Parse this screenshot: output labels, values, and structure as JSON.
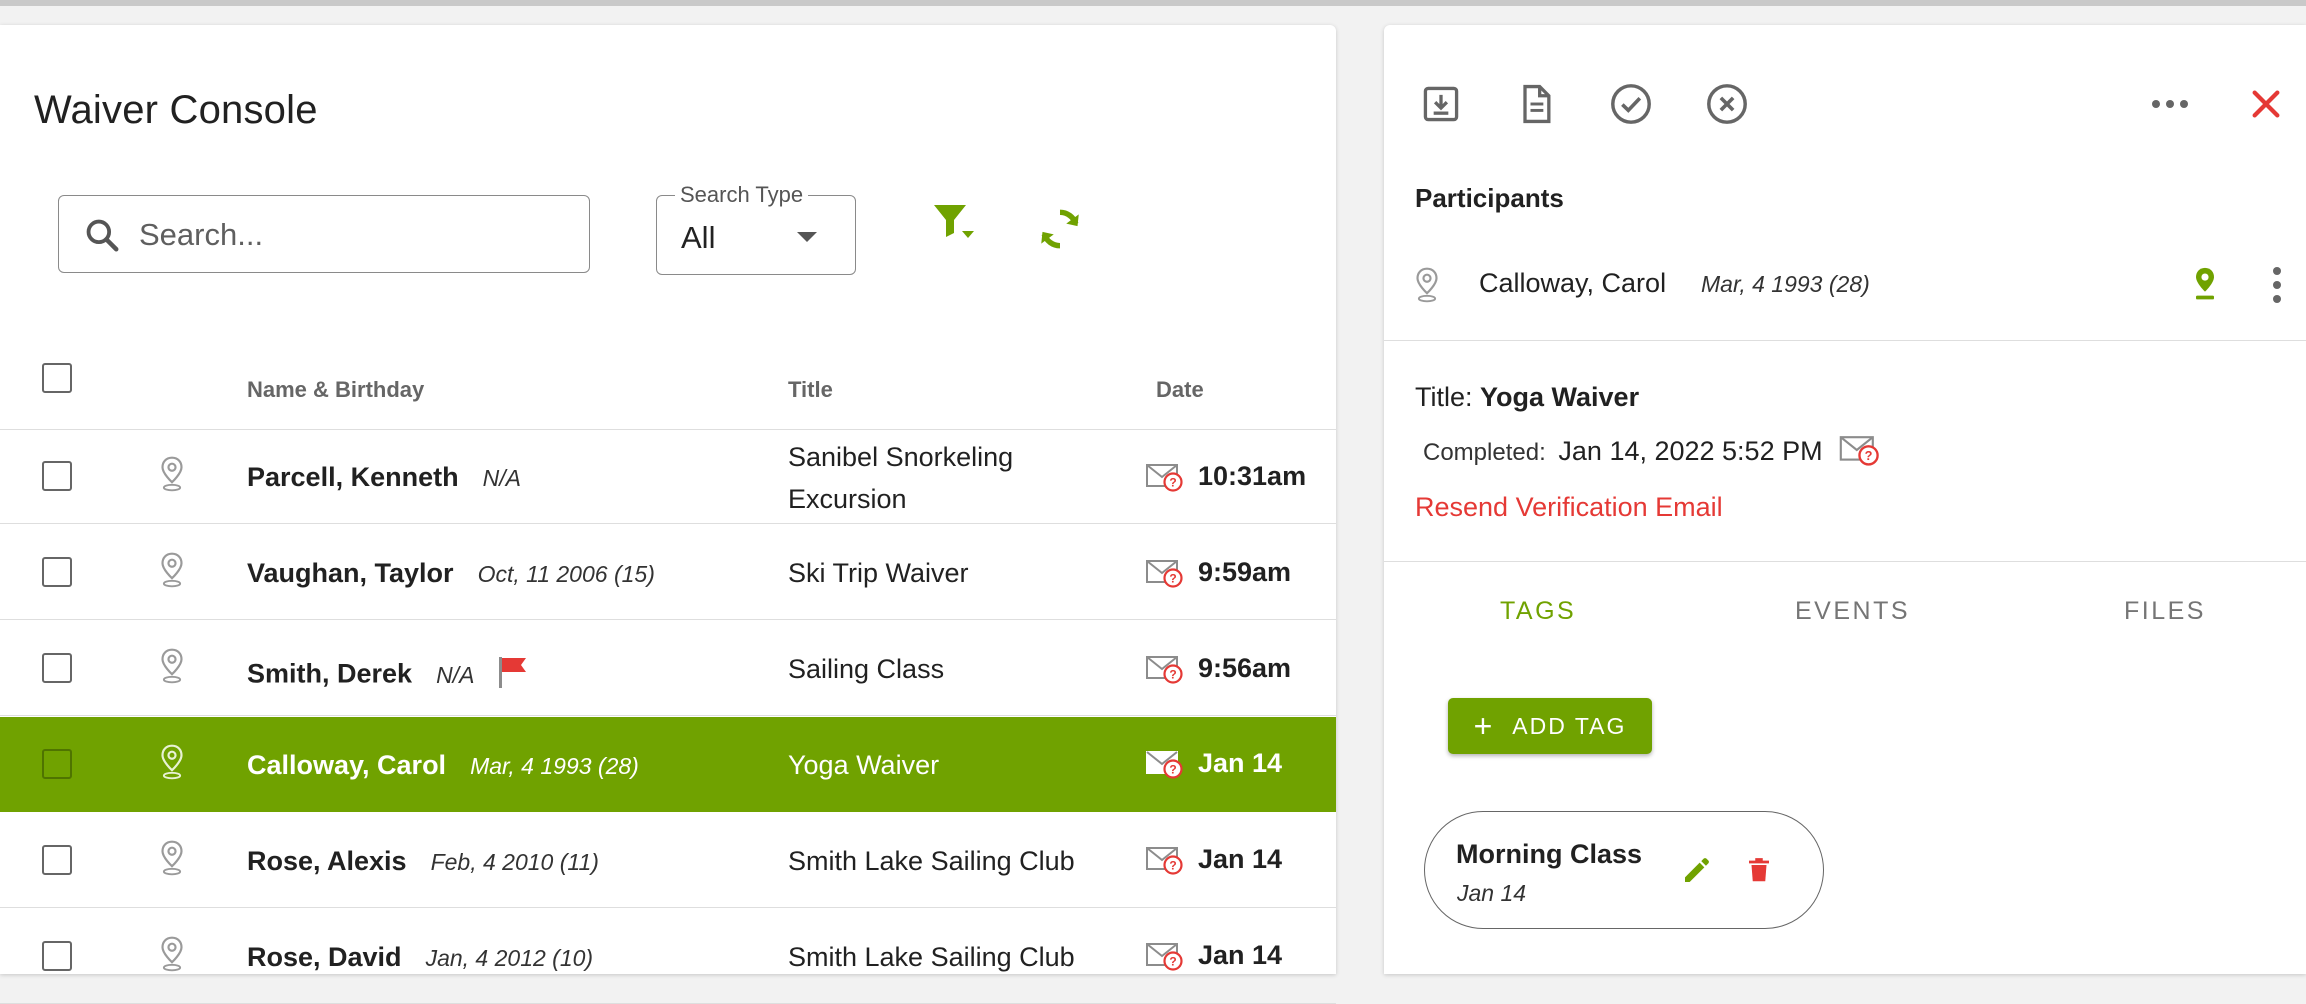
{
  "console": {
    "title": "Waiver Console",
    "search_placeholder": "Search...",
    "search_type_label": "Search Type",
    "search_type_value": "All",
    "filter_icon": "filter-icon",
    "refresh_icon": "refresh-icon"
  },
  "table": {
    "columns": [
      "Name & Birthday",
      "Title",
      "Date"
    ],
    "rows": [
      {
        "name": "Parcell, Kenneth",
        "birthday": "N/A",
        "title": "Sanibel Snorkeling Excursion",
        "time": "10:31am",
        "flagged": false,
        "selected": false
      },
      {
        "name": "Vaughan, Taylor",
        "birthday": "Oct, 11 2006 (15)",
        "title": "Ski Trip Waiver",
        "time": "9:59am",
        "flagged": false,
        "selected": false
      },
      {
        "name": "Smith, Derek",
        "birthday": "N/A",
        "title": "Sailing Class",
        "time": "9:56am",
        "flagged": true,
        "selected": false
      },
      {
        "name": "Calloway, Carol",
        "birthday": "Mar, 4 1993 (28)",
        "title": "Yoga Waiver",
        "time": "Jan 14",
        "flagged": false,
        "selected": true
      },
      {
        "name": "Rose, Alexis",
        "birthday": "Feb, 4 2010 (11)",
        "title": "Smith Lake Sailing Club",
        "time": "Jan 14",
        "flagged": false,
        "selected": false
      },
      {
        "name": "Rose, David",
        "birthday": "Jan, 4 2012 (10)",
        "title": "Smith Lake Sailing Club",
        "time": "Jan 14",
        "flagged": false,
        "selected": false
      }
    ]
  },
  "detail": {
    "toolbar_icons": [
      "download-icon",
      "document-icon",
      "check-circle-icon",
      "cancel-circle-icon",
      "more-horizontal-icon",
      "close-icon"
    ],
    "participants_label": "Participants",
    "participant": {
      "name": "Calloway, Carol",
      "birthday": "Mar, 4 1993 (28)"
    },
    "title_label": "Title:",
    "title_value": "Yoga Waiver",
    "completed_label": "Completed:",
    "completed_value": "Jan 14, 2022 5:52 PM",
    "resend_label": "Resend Verification Email",
    "tabs": [
      {
        "label": "TAGS",
        "active": true
      },
      {
        "label": "EVENTS",
        "active": false
      },
      {
        "label": "FILES",
        "active": false
      }
    ],
    "add_tag_label": "ADD TAG",
    "tag": {
      "name": "Morning Class",
      "date": "Jan 14"
    }
  },
  "colors": {
    "accent": "#70a200",
    "danger": "#e53935",
    "flag": "#e53935"
  }
}
